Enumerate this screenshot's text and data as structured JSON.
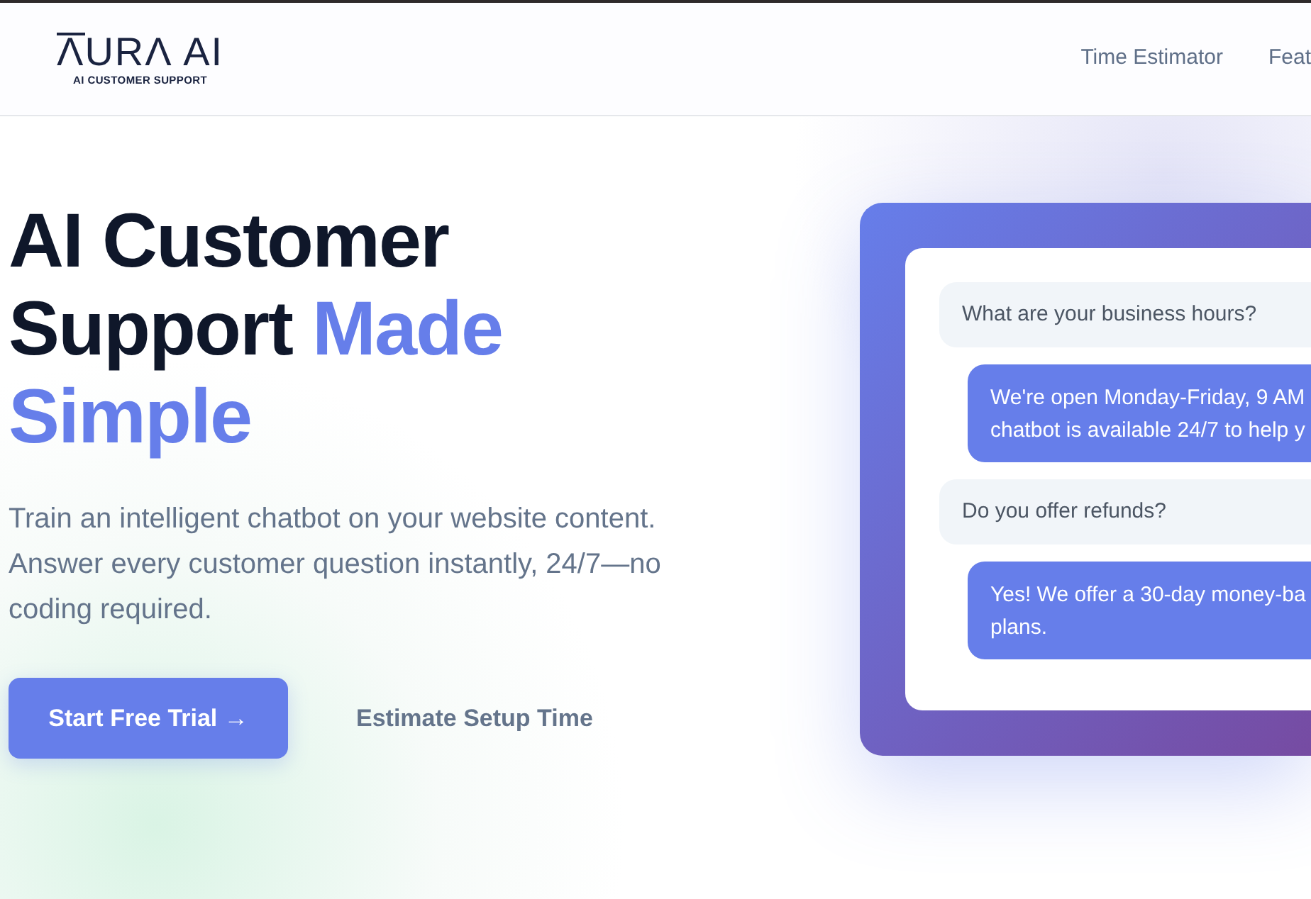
{
  "header": {
    "logo": {
      "wordmark": "ΛURΛ AI",
      "tagline": "AI CUSTOMER SUPPORT"
    },
    "nav": [
      {
        "label": "Time Estimator"
      },
      {
        "label": "Feat"
      }
    ]
  },
  "hero": {
    "heading": {
      "text": "AI Customer Support",
      "highlight": "Made Simple"
    },
    "description": "Train an intelligent chatbot on your website content. Answer every customer question instantly, 24/7—no coding required.",
    "buttons": [
      {
        "kind": "primary",
        "label": "Start Free Trial →"
      },
      {
        "kind": "link",
        "label": "Estimate Setup Time"
      }
    ]
  },
  "chat_preview": {
    "messages": [
      {
        "kind": "user",
        "lines": [
          "What are your business hours?"
        ]
      },
      {
        "kind": "bot",
        "lines": [
          "We're open Monday-Friday, 9 AM",
          "chatbot is available 24/7 to help y"
        ]
      },
      {
        "kind": "user",
        "lines": [
          "Do you offer refunds?"
        ]
      },
      {
        "kind": "bot",
        "lines": [
          "Yes! We offer a 30-day money-ba",
          "plans."
        ]
      }
    ]
  }
}
